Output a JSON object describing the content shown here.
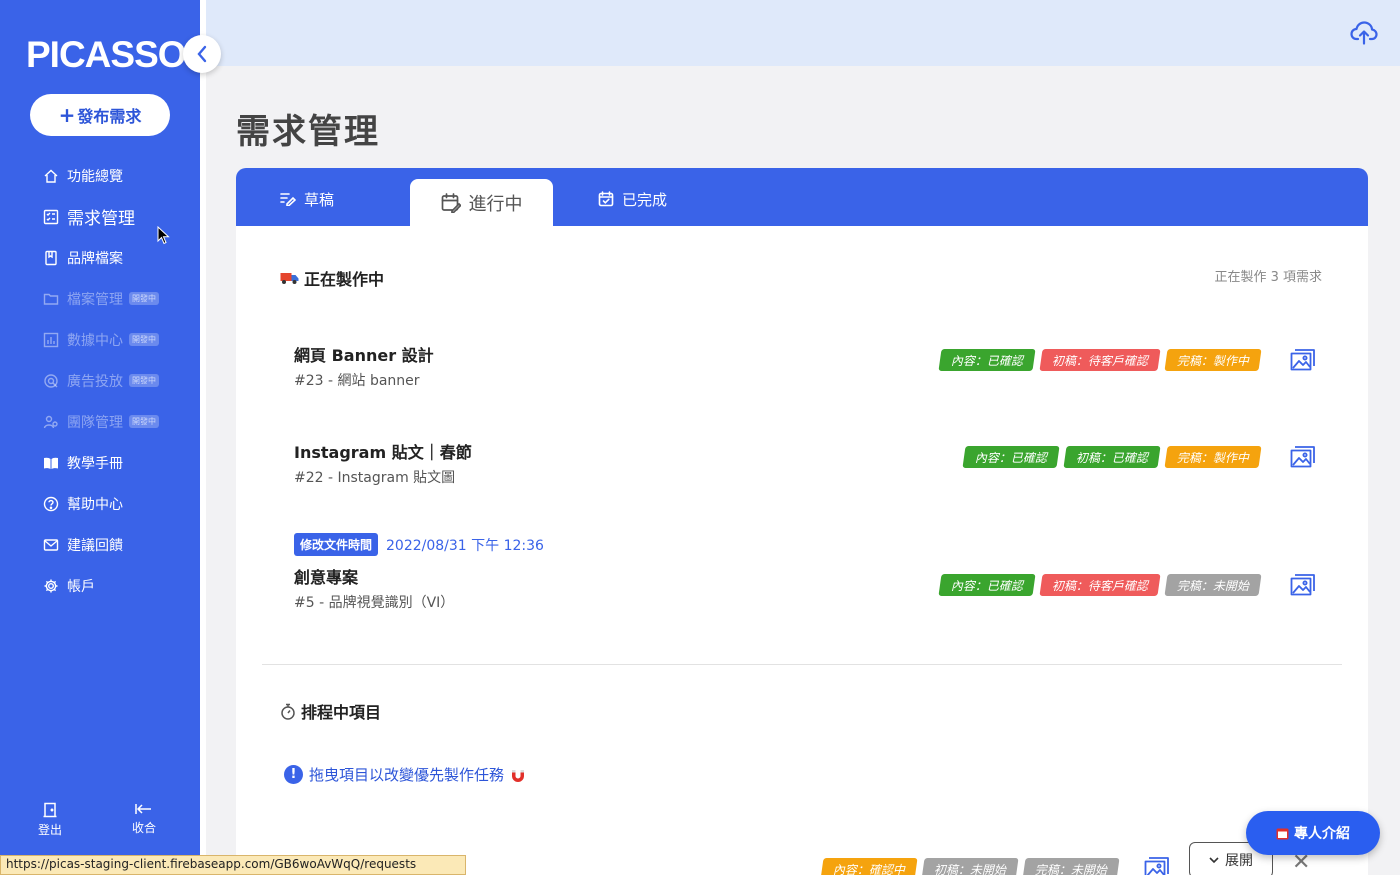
{
  "sidebar": {
    "logo": "PICASSO",
    "publish_label": "發布需求",
    "items": [
      {
        "label": "功能總覽",
        "icon": "home-icon"
      },
      {
        "label": "需求管理",
        "icon": "checklist-icon"
      },
      {
        "label": "品牌檔案",
        "icon": "book-icon"
      },
      {
        "label": "檔案管理",
        "icon": "folder-icon",
        "badge": "開發中"
      },
      {
        "label": "數據中心",
        "icon": "chart-icon",
        "badge": "開發中"
      },
      {
        "label": "廣告投放",
        "icon": "target-icon",
        "badge": "開發中"
      },
      {
        "label": "團隊管理",
        "icon": "team-icon",
        "badge": "開發中"
      },
      {
        "label": "教學手冊",
        "icon": "open-book-icon"
      },
      {
        "label": "幫助中心",
        "icon": "help-icon"
      },
      {
        "label": "建議回饋",
        "icon": "mail-icon"
      },
      {
        "label": "帳戶",
        "icon": "gear-icon"
      }
    ],
    "logout_label": "登出",
    "collapse_label": "收合"
  },
  "page": {
    "title": "需求管理"
  },
  "tabs": [
    {
      "label": "草稿"
    },
    {
      "label": "進行中"
    },
    {
      "label": "已完成"
    }
  ],
  "in_progress": {
    "title": "正在製作中",
    "count_text": "正在製作 3 項需求",
    "items": [
      {
        "name": "網頁 Banner 設計",
        "sub": "#23 - 網站 banner",
        "tags": [
          {
            "text": "內容：已確認",
            "color": "green"
          },
          {
            "text": "初稿：待客戶確認",
            "color": "red"
          },
          {
            "text": "完稿：製作中",
            "color": "orange"
          }
        ]
      },
      {
        "name": "Instagram 貼文｜春節",
        "sub": "#22 - Instagram 貼文圖",
        "tags": [
          {
            "text": "內容：已確認",
            "color": "green"
          },
          {
            "text": "初稿：已確認",
            "color": "green"
          },
          {
            "text": "完稿：製作中",
            "color": "orange"
          }
        ]
      },
      {
        "name": "創意專案",
        "sub": "#5 - 品牌視覺識別（VI）",
        "modified_label": "修改文件時間",
        "modified_time": "2022/08/31 下午 12:36",
        "tags": [
          {
            "text": "內容：已確認",
            "color": "green"
          },
          {
            "text": "初稿：待客戶確認",
            "color": "red"
          },
          {
            "text": "完稿：未開始",
            "color": "gray"
          }
        ]
      }
    ]
  },
  "scheduled": {
    "title": "排程中項目",
    "hint": "拖曳項目以改變優先製作任務"
  },
  "bottom_row": {
    "tags": [
      {
        "text": "內容：確認中",
        "color": "orange"
      },
      {
        "text": "初稿：未開始",
        "color": "gray"
      },
      {
        "text": "完稿：未開始",
        "color": "gray"
      }
    ],
    "expand_label": "展開"
  },
  "intro_button": "專人介紹",
  "status_url": "https://picas-staging-client.firebaseapp.com/GB6woAvWqQ/requests",
  "colors": {
    "primary": "#3a63e8",
    "green": "#3aa52e",
    "red": "#ef5b5b",
    "orange": "#f5a30e",
    "gray": "#a3a3a3"
  }
}
